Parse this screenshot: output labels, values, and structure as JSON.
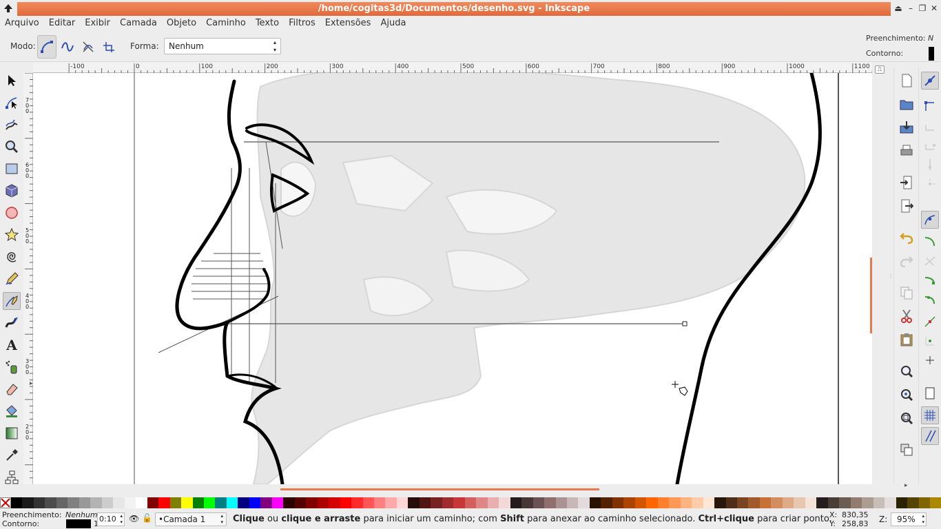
{
  "window": {
    "title": "/home/cogitas3d/Documentos/desenho.svg - Inkscape"
  },
  "menu": [
    "Arquivo",
    "Editar",
    "Exibir",
    "Camada",
    "Objeto",
    "Caminho",
    "Texto",
    "Filtros",
    "Extensões",
    "Ajuda"
  ],
  "toolctrl": {
    "mode_label": "Modo:",
    "shape_label": "Forma:",
    "shape_value": "Nenhum"
  },
  "style_indicator": {
    "fill_label": "Preenchimento:",
    "fill_value": "N",
    "stroke_label": "Contorno:"
  },
  "hruler": {
    "ticks": [
      "-100",
      "0",
      "100",
      "200",
      "300",
      "400",
      "500",
      "600",
      "700",
      "800",
      "900",
      "1000",
      "1100"
    ]
  },
  "vruler": {
    "ticks": [
      "700",
      "600",
      "500",
      "400",
      "300",
      "200"
    ]
  },
  "palette": [
    "#000000",
    "#1a1a1a",
    "#333333",
    "#4d4d4d",
    "#666666",
    "#808080",
    "#999999",
    "#b3b3b3",
    "#cccccc",
    "#e6e6e6",
    "#f2f2f2",
    "#ffffff",
    "#800000",
    "#ff0000",
    "#808000",
    "#ffff00",
    "#008000",
    "#00ff00",
    "#008080",
    "#00ffff",
    "#000080",
    "#0000ff",
    "#800080",
    "#ff00ff",
    "#2b0000",
    "#550000",
    "#800000",
    "#aa0000",
    "#d40000",
    "#ff0000",
    "#ff2a2a",
    "#ff5555",
    "#ff8080",
    "#ffaaaa",
    "#ffd5d5",
    "#280b0b",
    "#501616",
    "#782121",
    "#a02c2c",
    "#c83737",
    "#d35f5f",
    "#de8787",
    "#e9afaf",
    "#f4d7d7",
    "#241c1c",
    "#483737",
    "#6c5353",
    "#916f6f",
    "#ac9393",
    "#c8b7b7",
    "#e3dbdb",
    "#2b1100",
    "#552200",
    "#803300",
    "#aa4400",
    "#d45500",
    "#ff6600",
    "#ff7f2a",
    "#ff9955",
    "#ffb380",
    "#ffccaa",
    "#ffe6d5",
    "#28170b",
    "#502d16",
    "#784421",
    "#a05a2c",
    "#c87137",
    "#d38d5f",
    "#deaa87",
    "#e9c6af",
    "#f4e3d7",
    "#241f1c",
    "#483e37",
    "#6c5d53",
    "#917c6f",
    "#ac9d93",
    "#c8beb7",
    "#e3dedb",
    "#2b2200",
    "#554400",
    "#806600",
    "#aa8800"
  ],
  "status": {
    "fill_label": "Preenchimento:",
    "fill_value": "Nenhum",
    "stroke_label": "Contorno:",
    "stroke_width": "1",
    "opacity_value": "0:10",
    "layer": "•Camada 1",
    "message_parts": [
      "Clique",
      " ou ",
      "clique e arraste",
      " para iniciar um caminho; com ",
      "Shift",
      " para anexar ao caminho selecionado. ",
      "Ctrl+clique",
      " para criar ponto."
    ],
    "x_label": "X:",
    "x_value": "830,35",
    "y_label": "Y:",
    "y_value": "258,83",
    "zoom_label": "Z:",
    "zoom_value": "95%"
  },
  "colors": {
    "title_accent": "#e8774a",
    "canvas": "#ffffff",
    "chrome": "#ededed"
  }
}
